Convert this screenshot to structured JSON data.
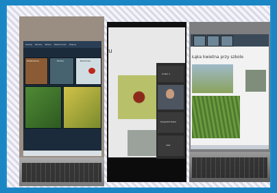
{
  "panel_left": {
    "tabs": [
      "Szukaj",
      "Obrazy",
      "Wideo",
      "Wiadomości",
      "Więcej"
    ],
    "tiles": [
      {
        "label": "Dżdżownica",
        "color": "#a76d3a"
      },
      {
        "label": "Mucha",
        "color": "#6e8b9d"
      },
      {
        "label": "Biedronka",
        "color": "#c4d2d8"
      },
      {
        "label": "",
        "color": "#5a8a38"
      },
      {
        "label": "",
        "color": "#b0a23a"
      }
    ]
  },
  "panel_middle": {
    "title_fragment": "u",
    "participants": [
      {
        "label": "Uczeń 1"
      },
      {
        "label": "Krzysztof Sobol"
      },
      {
        "label": "user"
      }
    ]
  },
  "panel_right": {
    "slide_title": "Łąka kwietna przy szkole"
  }
}
